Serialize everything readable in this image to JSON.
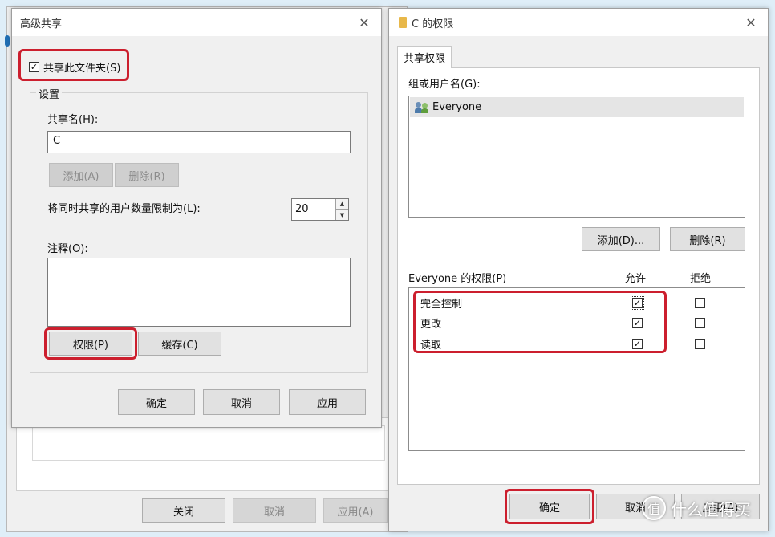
{
  "background_window": {
    "buttons": [
      {
        "label": "关闭",
        "enabled": true
      },
      {
        "label": "取消",
        "enabled": false
      },
      {
        "label": "应用(A)",
        "enabled": false
      }
    ]
  },
  "advanced_sharing": {
    "title": "高级共享",
    "share_checkbox": {
      "label": "共享此文件夹(S)",
      "checked": true
    },
    "settings_group": "设置",
    "share_name_label": "共享名(H):",
    "share_name_value": "C",
    "add_button": "添加(A)",
    "remove_button": "删除(R)",
    "limit_label": "将同时共享的用户数量限制为(L):",
    "limit_value": "20",
    "comment_label": "注释(O):",
    "comment_value": "",
    "permissions_button": "权限(P)",
    "caching_button": "缓存(C)",
    "ok_button": "确定",
    "cancel_button": "取消",
    "apply_button": "应用"
  },
  "permissions_dialog": {
    "title": "C 的权限",
    "tab": "共享权限",
    "group_label": "组或用户名(G):",
    "users": [
      "Everyone"
    ],
    "add_button": "添加(D)...",
    "remove_button": "删除(R)",
    "perm_label": "Everyone 的权限(P)",
    "allow_header": "允许",
    "deny_header": "拒绝",
    "permissions": [
      {
        "name": "完全控制",
        "allow": true,
        "deny": false
      },
      {
        "name": "更改",
        "allow": true,
        "deny": false
      },
      {
        "name": "读取",
        "allow": true,
        "deny": false
      }
    ],
    "ok_button": "确定",
    "cancel_button": "取消",
    "apply_button": "应用(A)"
  },
  "watermark": {
    "text": "什么值得买",
    "logo": "值"
  },
  "colors": {
    "highlight": "#cc1f2e",
    "folder": "#e8b84a"
  }
}
